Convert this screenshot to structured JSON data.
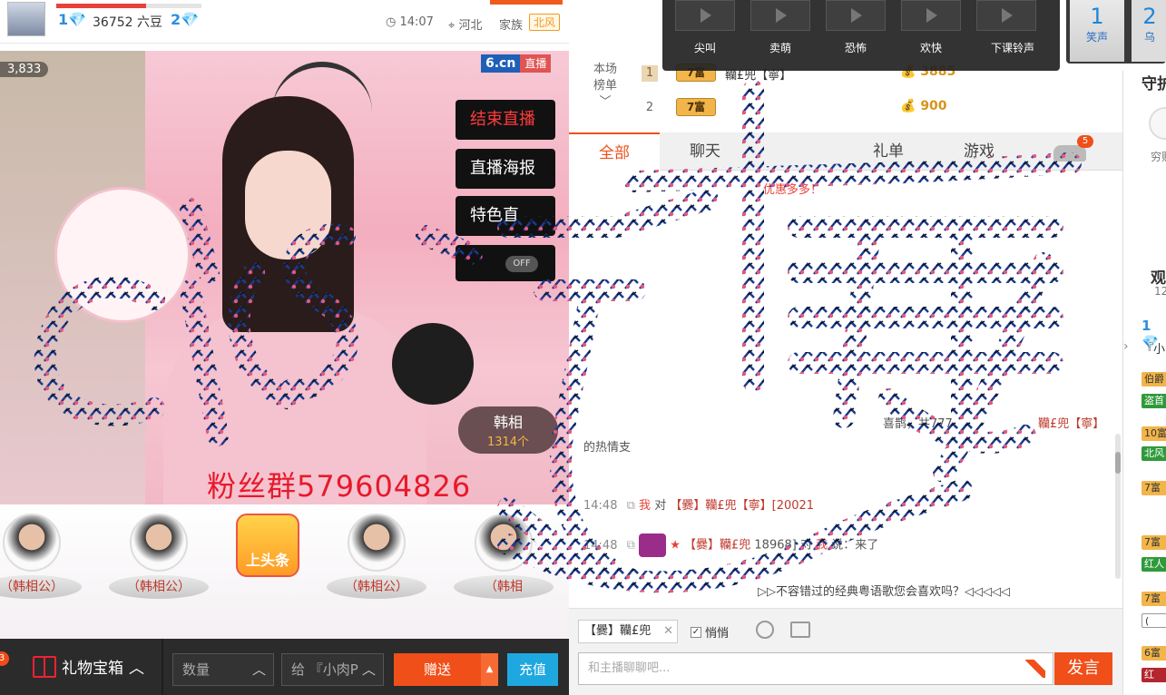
{
  "header": {
    "level_badge_1": "1",
    "dou_count": "36752 六豆",
    "level_badge_2": "2",
    "time": "14:07",
    "location": "河北",
    "family_label": "家族",
    "family_badge": "北风"
  },
  "video": {
    "viewers": "3,833",
    "brand": "6.cn",
    "live_tag": "直播",
    "buttons": {
      "end_live": "结束直播",
      "poster": "直播海报",
      "special": "特色直"
    },
    "toggle_label": "OFF",
    "fans_group": "粉丝群579604826",
    "gift_name": "韩相",
    "gift_count": "1314个"
  },
  "guards": {
    "names": [
      "（韩相公）",
      "（韩相公）",
      "（韩相公）",
      "（韩相"
    ],
    "headline": "上头条"
  },
  "gift_bar": {
    "badge": "3",
    "gift_box": "礼物宝箱",
    "quantity_placeholder": "数量",
    "to_label": "给",
    "to_value": "『小肉P",
    "send": "赠送",
    "recharge": "充值"
  },
  "sounds": {
    "items": [
      "尖叫",
      "卖萌",
      "恐怖",
      "欢快",
      "下课铃声"
    ],
    "laugh": "笑声",
    "laugh_num": "1",
    "crow": "乌",
    "crow_num": "2"
  },
  "rank": {
    "label_line1": "本场",
    "label_line2": "榜单",
    "rows": [
      {
        "num": "1",
        "tag": "7富",
        "name": "韊£兜【寧】",
        "score": "3885"
      },
      {
        "num": "2",
        "tag": "7富",
        "name": "",
        "score": "900"
      }
    ]
  },
  "tabs": {
    "all": "全部",
    "chat": "聊天",
    "gifts": "礼单",
    "games": "游戏",
    "car_badge": "5"
  },
  "chat": {
    "notice": "优惠多多！",
    "lines": [
      {
        "text": "喜鹊，共777",
        "name": "韊£兜【寧】"
      },
      {
        "text": "的热情支"
      },
      {
        "time": "14:48",
        "me": "我",
        "mid": "对",
        "name": "【爨】韊£兜【寧】[20021",
        "rest": ""
      },
      {
        "time": "14:48",
        "name": "【爨】韊£兜",
        "mid": "18968] 对",
        "me": "我",
        "rest": "说：来了"
      }
    ],
    "song": "▷▷不容错过的经典粤语歌您会喜欢吗？◁◁◁◁◁"
  },
  "input": {
    "target": "【爨】韊£兜",
    "quiet_label": "悄悄",
    "placeholder": "和主播聊聊吧...",
    "post": "发言"
  },
  "side": {
    "guard_title": "守护",
    "poor_label": "穷财",
    "watch_title": "观",
    "watch_num": "12",
    "level": "1",
    "user_short": "『小",
    "chips": [
      "伯爵",
      "盗首",
      "10富",
      "北风",
      "7富",
      "7富",
      "红人",
      "7富",
      "(",
      "6富",
      "红"
    ]
  },
  "colors": {
    "accent": "#f04f1a",
    "blue": "#1d86d8",
    "fans_red": "#e8192c"
  }
}
